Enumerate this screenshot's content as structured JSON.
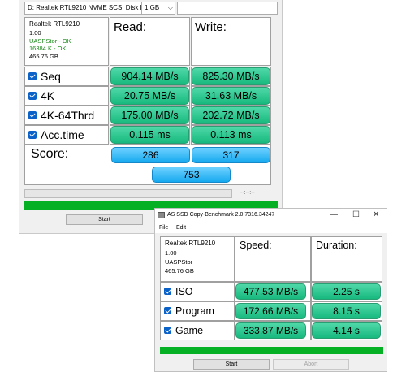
{
  "main": {
    "drive_selector": "D: Realtek RTL9210 NVME SCSI Disk De",
    "size_selector": "1 GB",
    "info": {
      "name": "Realtek RTL9210",
      "version": "1.00",
      "driver": "UASPStor - OK",
      "alignment": "16384 K - OK",
      "capacity": "465.76 GB"
    },
    "read_header": "Read:",
    "write_header": "Write:",
    "rows": [
      {
        "label": "Seq",
        "read": "904.14 MB/s",
        "write": "825.30 MB/s"
      },
      {
        "label": "4K",
        "read": "20.75 MB/s",
        "write": "31.63 MB/s"
      },
      {
        "label": "4K-64Thrd",
        "read": "175.00 MB/s",
        "write": "202.72 MB/s"
      },
      {
        "label": "Acc.time",
        "read": "0.115 ms",
        "write": "0.113 ms"
      }
    ],
    "score_label": "Score:",
    "score_read": "286",
    "score_write": "317",
    "score_total": "753",
    "elapsed": "--:--:--",
    "start_label": "Start"
  },
  "copy": {
    "title": "AS SSD Copy-Benchmark 2.0.7316.34247",
    "menu": {
      "file": "File",
      "edit": "Edit"
    },
    "info": {
      "name": "Realtek RTL9210",
      "version": "1.00",
      "driver": "UASPStor",
      "capacity": "465.76 GB"
    },
    "speed_header": "Speed:",
    "duration_header": "Duration:",
    "rows": [
      {
        "label": "ISO",
        "speed": "477.53 MB/s",
        "duration": "2.25 s"
      },
      {
        "label": "Program",
        "speed": "172.66 MB/s",
        "duration": "8.15 s"
      },
      {
        "label": "Game",
        "speed": "333.87 MB/s",
        "duration": "4.14 s"
      }
    ],
    "start_label": "Start",
    "abort_label": "Abort",
    "controls": {
      "minimize": "—",
      "maximize": "☐",
      "close": "✕"
    }
  },
  "colors": {
    "green_value": "#17b97f",
    "blue_value": "#16a9ef",
    "progress_green": "#06b025",
    "checkbox": "#0a62c8"
  }
}
